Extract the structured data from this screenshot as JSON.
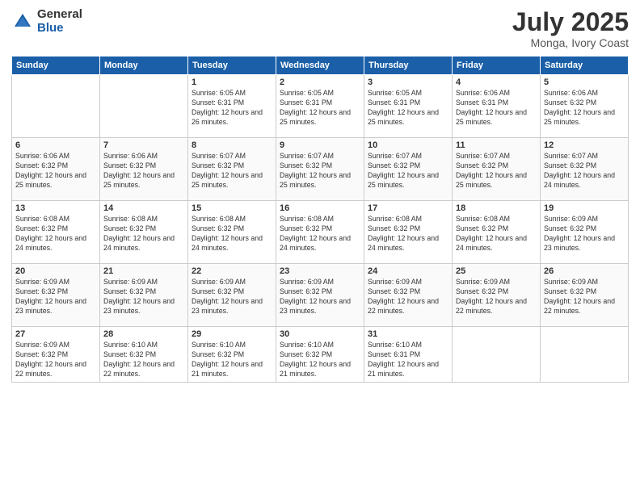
{
  "logo": {
    "general": "General",
    "blue": "Blue"
  },
  "title": "July 2025",
  "location": "Monga, Ivory Coast",
  "weekdays": [
    "Sunday",
    "Monday",
    "Tuesday",
    "Wednesday",
    "Thursday",
    "Friday",
    "Saturday"
  ],
  "weeks": [
    [
      {
        "day": "",
        "info": ""
      },
      {
        "day": "",
        "info": ""
      },
      {
        "day": "1",
        "info": "Sunrise: 6:05 AM\nSunset: 6:31 PM\nDaylight: 12 hours and 26 minutes."
      },
      {
        "day": "2",
        "info": "Sunrise: 6:05 AM\nSunset: 6:31 PM\nDaylight: 12 hours and 25 minutes."
      },
      {
        "day": "3",
        "info": "Sunrise: 6:05 AM\nSunset: 6:31 PM\nDaylight: 12 hours and 25 minutes."
      },
      {
        "day": "4",
        "info": "Sunrise: 6:06 AM\nSunset: 6:31 PM\nDaylight: 12 hours and 25 minutes."
      },
      {
        "day": "5",
        "info": "Sunrise: 6:06 AM\nSunset: 6:32 PM\nDaylight: 12 hours and 25 minutes."
      }
    ],
    [
      {
        "day": "6",
        "info": "Sunrise: 6:06 AM\nSunset: 6:32 PM\nDaylight: 12 hours and 25 minutes."
      },
      {
        "day": "7",
        "info": "Sunrise: 6:06 AM\nSunset: 6:32 PM\nDaylight: 12 hours and 25 minutes."
      },
      {
        "day": "8",
        "info": "Sunrise: 6:07 AM\nSunset: 6:32 PM\nDaylight: 12 hours and 25 minutes."
      },
      {
        "day": "9",
        "info": "Sunrise: 6:07 AM\nSunset: 6:32 PM\nDaylight: 12 hours and 25 minutes."
      },
      {
        "day": "10",
        "info": "Sunrise: 6:07 AM\nSunset: 6:32 PM\nDaylight: 12 hours and 25 minutes."
      },
      {
        "day": "11",
        "info": "Sunrise: 6:07 AM\nSunset: 6:32 PM\nDaylight: 12 hours and 25 minutes."
      },
      {
        "day": "12",
        "info": "Sunrise: 6:07 AM\nSunset: 6:32 PM\nDaylight: 12 hours and 24 minutes."
      }
    ],
    [
      {
        "day": "13",
        "info": "Sunrise: 6:08 AM\nSunset: 6:32 PM\nDaylight: 12 hours and 24 minutes."
      },
      {
        "day": "14",
        "info": "Sunrise: 6:08 AM\nSunset: 6:32 PM\nDaylight: 12 hours and 24 minutes."
      },
      {
        "day": "15",
        "info": "Sunrise: 6:08 AM\nSunset: 6:32 PM\nDaylight: 12 hours and 24 minutes."
      },
      {
        "day": "16",
        "info": "Sunrise: 6:08 AM\nSunset: 6:32 PM\nDaylight: 12 hours and 24 minutes."
      },
      {
        "day": "17",
        "info": "Sunrise: 6:08 AM\nSunset: 6:32 PM\nDaylight: 12 hours and 24 minutes."
      },
      {
        "day": "18",
        "info": "Sunrise: 6:08 AM\nSunset: 6:32 PM\nDaylight: 12 hours and 24 minutes."
      },
      {
        "day": "19",
        "info": "Sunrise: 6:09 AM\nSunset: 6:32 PM\nDaylight: 12 hours and 23 minutes."
      }
    ],
    [
      {
        "day": "20",
        "info": "Sunrise: 6:09 AM\nSunset: 6:32 PM\nDaylight: 12 hours and 23 minutes."
      },
      {
        "day": "21",
        "info": "Sunrise: 6:09 AM\nSunset: 6:32 PM\nDaylight: 12 hours and 23 minutes."
      },
      {
        "day": "22",
        "info": "Sunrise: 6:09 AM\nSunset: 6:32 PM\nDaylight: 12 hours and 23 minutes."
      },
      {
        "day": "23",
        "info": "Sunrise: 6:09 AM\nSunset: 6:32 PM\nDaylight: 12 hours and 23 minutes."
      },
      {
        "day": "24",
        "info": "Sunrise: 6:09 AM\nSunset: 6:32 PM\nDaylight: 12 hours and 22 minutes."
      },
      {
        "day": "25",
        "info": "Sunrise: 6:09 AM\nSunset: 6:32 PM\nDaylight: 12 hours and 22 minutes."
      },
      {
        "day": "26",
        "info": "Sunrise: 6:09 AM\nSunset: 6:32 PM\nDaylight: 12 hours and 22 minutes."
      }
    ],
    [
      {
        "day": "27",
        "info": "Sunrise: 6:09 AM\nSunset: 6:32 PM\nDaylight: 12 hours and 22 minutes."
      },
      {
        "day": "28",
        "info": "Sunrise: 6:10 AM\nSunset: 6:32 PM\nDaylight: 12 hours and 22 minutes."
      },
      {
        "day": "29",
        "info": "Sunrise: 6:10 AM\nSunset: 6:32 PM\nDaylight: 12 hours and 21 minutes."
      },
      {
        "day": "30",
        "info": "Sunrise: 6:10 AM\nSunset: 6:32 PM\nDaylight: 12 hours and 21 minutes."
      },
      {
        "day": "31",
        "info": "Sunrise: 6:10 AM\nSunset: 6:31 PM\nDaylight: 12 hours and 21 minutes."
      },
      {
        "day": "",
        "info": ""
      },
      {
        "day": "",
        "info": ""
      }
    ]
  ]
}
